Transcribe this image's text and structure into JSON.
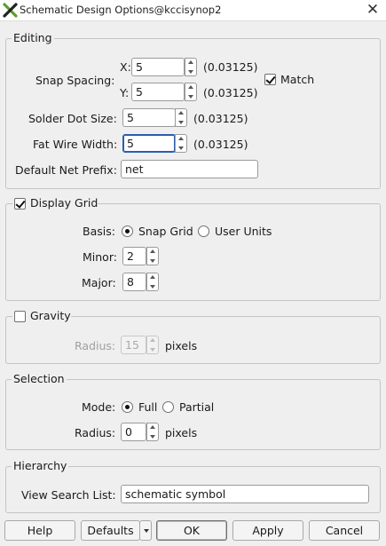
{
  "window": {
    "title": "Schematic Design Options@kccisynop2",
    "close_glyph": "✕"
  },
  "editing": {
    "legend": "Editing",
    "snap_spacing_label": "Snap Spacing:",
    "x_label": "X:",
    "x_value": "5",
    "x_units": "(0.03125)",
    "y_label": "Y:",
    "y_value": "5",
    "y_units": "(0.03125)",
    "match_label": "Match",
    "match_checked": true,
    "solder_dot_label": "Solder Dot Size:",
    "solder_dot_value": "5",
    "solder_dot_units": "(0.03125)",
    "fat_wire_label": "Fat Wire Width:",
    "fat_wire_value": "5",
    "fat_wire_units": "(0.03125)",
    "net_prefix_label": "Default Net Prefix:",
    "net_prefix_value": "net"
  },
  "display_grid": {
    "legend": "Display Grid",
    "checked": true,
    "basis_label": "Basis:",
    "basis_options": [
      "Snap Grid",
      "User Units"
    ],
    "basis_selected": "Snap Grid",
    "minor_label": "Minor:",
    "minor_value": "2",
    "major_label": "Major:",
    "major_value": "8"
  },
  "gravity": {
    "legend": "Gravity",
    "checked": false,
    "radius_label": "Radius:",
    "radius_value": "15",
    "radius_units": "pixels"
  },
  "selection": {
    "legend": "Selection",
    "mode_label": "Mode:",
    "mode_options": [
      "Full",
      "Partial"
    ],
    "mode_selected": "Full",
    "radius_label": "Radius:",
    "radius_value": "0",
    "radius_units": "pixels"
  },
  "hierarchy": {
    "legend": "Hierarchy",
    "view_search_label": "View Search List:",
    "view_search_value": "schematic symbol"
  },
  "buttons": {
    "help": "Help",
    "defaults": "Defaults",
    "ok": "OK",
    "apply": "Apply",
    "cancel": "Cancel"
  },
  "colors": {
    "accent": "#2a5db0",
    "background": "#efefef",
    "logo_green": "#5aa02c",
    "logo_dark": "#222222"
  }
}
